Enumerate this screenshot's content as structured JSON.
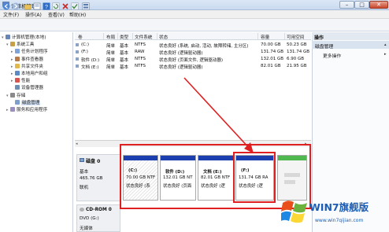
{
  "window": {
    "title": "计算机管理"
  },
  "window_buttons": {
    "minimize": "–",
    "maximize": "□",
    "close": "✕"
  },
  "menu": [
    "文件(F)",
    "操作(A)",
    "查看(V)",
    "帮助(H)"
  ],
  "tree": [
    {
      "label": "计算机管理(本地)",
      "arrow": "▾",
      "icon": "computer-icon",
      "color": "#6a86b5"
    },
    {
      "label": "系统工具",
      "arrow": "▾",
      "icon": "tools-icon",
      "color": "#c8a04a"
    },
    {
      "label": "任务计划程序",
      "arrow": "▸",
      "icon": "task-scheduler-icon",
      "color": "#7da3d8"
    },
    {
      "label": "事件查看器",
      "arrow": "▸",
      "icon": "event-viewer-icon",
      "color": "#b77b4b"
    },
    {
      "label": "共享文件夹",
      "arrow": "▸",
      "icon": "shared-folder-icon",
      "color": "#e1b84b"
    },
    {
      "label": "本地用户和组",
      "arrow": "▸",
      "icon": "users-icon",
      "color": "#5c8ac5"
    },
    {
      "label": "性能",
      "arrow": "▸",
      "icon": "performance-icon",
      "color": "#d9534f"
    },
    {
      "label": "设备管理器",
      "arrow": "",
      "icon": "device-manager-icon",
      "color": "#6e8fb3"
    },
    {
      "label": "存储",
      "arrow": "▾",
      "icon": "storage-icon",
      "color": "#8a8a8a"
    },
    {
      "label": "磁盘管理",
      "arrow": "",
      "icon": "disk-management-icon",
      "color": "#7c9fcb"
    },
    {
      "label": "服务和应用程序",
      "arrow": "▸",
      "icon": "services-icon",
      "color": "#9a8fbf"
    }
  ],
  "volume_list": {
    "headers": [
      "卷",
      "布局",
      "类型",
      "文件系统",
      "状态",
      "容量",
      "可用空间"
    ],
    "rows": [
      [
        "(C:)",
        "简单",
        "基本",
        "NTFS",
        "状态良好 (系统, 启动, 活动, 故障转储, 主分区)",
        "70.00 GB",
        "50.23 GB"
      ],
      [
        "(F:)",
        "简单",
        "基本",
        "RAW",
        "状态良好 (逻辑驱动器)",
        "131.74 GB",
        "131.74 GB"
      ],
      [
        "软件 (D:)",
        "简单",
        "基本",
        "NTFS",
        "状态良好 (页面文件, 逻辑驱动器)",
        "132.01 GB",
        "6.90 GB"
      ],
      [
        "文档 (E:)",
        "简单",
        "基本",
        "NTFS",
        "状态良好 (逻辑驱动器)",
        "82.01 GB",
        "21.95 GB"
      ]
    ]
  },
  "actions": {
    "header": "操作",
    "section": "磁盘管理",
    "more": "更多操作"
  },
  "disk0": {
    "name": "磁盘 0",
    "type": "基本",
    "size": "465.76 GB",
    "status": "联机",
    "partitions": [
      {
        "label": "(C:)",
        "size": "70.00 GB NTF",
        "status": "状态良好 (系",
        "color": "#1c3fb0",
        "hatched": true
      },
      {
        "label": "软件 (D:)",
        "size": "132.01 GB NT",
        "status": "状态良好 (页面",
        "color": "#1c3fb0",
        "hatched": false
      },
      {
        "label": "文档 (E:)",
        "size": "82.01 GB NTF",
        "status": "状态良好 (逻",
        "color": "#1c3fb0",
        "hatched": false
      },
      {
        "label": "(F:)",
        "size": "131.74 GB RA",
        "status": "状态良好 (逻",
        "color": "#1c3fb0",
        "hatched": false
      }
    ]
  },
  "cdrom0": {
    "name": "CD-ROM 0",
    "type": "DVD (G:)",
    "status": "无媒体"
  },
  "watermark": {
    "text": "WIN7旗舰版",
    "url": "www.win7qijian.com"
  }
}
